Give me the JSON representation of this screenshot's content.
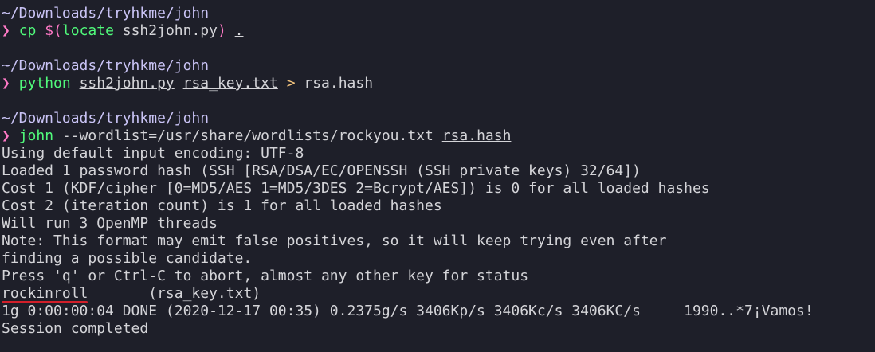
{
  "blocks": [
    {
      "cwd": "~/Downloads/tryhkme/john",
      "prompt": "❯",
      "command": "cp",
      "args": [
        {
          "text": " $(",
          "style": "sub"
        },
        {
          "text": "locate",
          "style": "cmd"
        },
        {
          "text": " ssh2john.py",
          "style": "arg"
        },
        {
          "text": ")",
          "style": "sub"
        },
        {
          "text": " ",
          "style": "arg"
        },
        {
          "text": ".",
          "style": "ul"
        }
      ]
    },
    {
      "cwd": "~/Downloads/tryhkme/john",
      "prompt": "❯",
      "command": "python",
      "args": [
        {
          "text": " ",
          "style": "arg"
        },
        {
          "text": "ssh2john.py",
          "style": "ul"
        },
        {
          "text": " ",
          "style": "arg"
        },
        {
          "text": "rsa_key.txt",
          "style": "ul"
        },
        {
          "text": " ",
          "style": "arg"
        },
        {
          "text": ">",
          "style": "redir"
        },
        {
          "text": " rsa.hash",
          "style": "arg"
        }
      ]
    },
    {
      "cwd": "~/Downloads/tryhkme/john",
      "prompt": "❯",
      "command": "john",
      "args": [
        {
          "text": " --wordlist=/usr/share/wordlists/rockyou.txt ",
          "style": "arg"
        },
        {
          "text": "rsa.hash",
          "style": "ul"
        }
      ]
    }
  ],
  "output": [
    "Using default input encoding: UTF-8",
    "Loaded 1 password hash (SSH [RSA/DSA/EC/OPENSSH (SSH private keys) 32/64])",
    "Cost 1 (KDF/cipher [0=MD5/AES 1=MD5/3DES 2=Bcrypt/AES]) is 0 for all loaded hashes",
    "Cost 2 (iteration count) is 1 for all loaded hashes",
    "Will run 3 OpenMP threads",
    "Note: This format may emit false positives, so it will keep trying even after",
    "finding a possible candidate.",
    "Press 'q' or Ctrl-C to abort, almost any other key for status"
  ],
  "cracked": {
    "password": "rockinroll",
    "spacer": "       ",
    "source": "(rsa_key.txt)"
  },
  "summary": [
    "1g 0:00:00:04 DONE (2020-12-17 00:35) 0.2375g/s 3406Kp/s 3406Kc/s 3406KC/s     1990..*7¡Vamos!",
    "Session completed"
  ],
  "colors": {
    "background": "#1e1f29",
    "cwd": "#c9c3f5",
    "prompt": "#ff79c6",
    "command": "#50fa7b",
    "output": "#d4d4d8",
    "redirect": "#f1c27d",
    "highlight_underline": "#d21f2a"
  }
}
